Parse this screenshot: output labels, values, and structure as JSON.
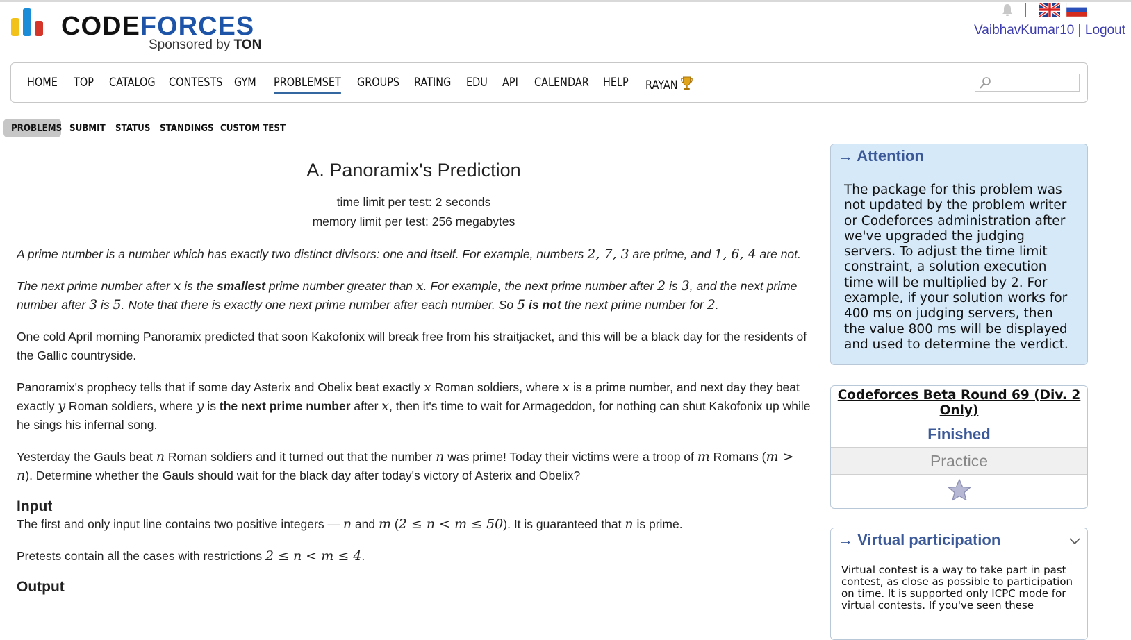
{
  "header": {
    "logo_text_left": "CODE",
    "logo_text_right": "FORCES",
    "sponsor_prefix": "Sponsored by ",
    "sponsor_name": "TON",
    "username": "VaibhavKumar10",
    "separator": "|",
    "logout": "Logout"
  },
  "nav": {
    "items": [
      "HOME",
      "TOP",
      "CATALOG",
      "CONTESTS",
      "GYM",
      "PROBLEMSET",
      "GROUPS",
      "RATING",
      "EDU",
      "API",
      "CALENDAR",
      "HELP",
      "RAYAN"
    ],
    "active": "PROBLEMSET"
  },
  "subnav": {
    "items": [
      "PROBLEMS",
      "SUBMIT",
      "STATUS",
      "STANDINGS",
      "CUSTOM TEST"
    ],
    "active": "PROBLEMS"
  },
  "problem": {
    "title": "A. Panoramix's Prediction",
    "time_limit": "time limit per test: 2 seconds",
    "memory_limit": "memory limit per test: 256 megabytes",
    "p1": {
      "a": "A prime number is a number which has exactly two distinct divisors: one and itself. For example, numbers ",
      "m1": "2, 7, 3",
      "b": " are prime, and ",
      "m2": "1, 6, 4",
      "c": " are not."
    },
    "p2": {
      "a": "The next prime number after ",
      "x1": "x",
      "b": " is the ",
      "bold1": "smallest",
      "c": " prime number greater than ",
      "x2": "x",
      "d": ". For example, the next prime number after ",
      "n2": "2",
      "e": " is ",
      "n3": "3",
      "f": ", and the next prime number after ",
      "n3b": "3",
      "g": " is ",
      "n5": "5",
      "h": ". Note that there is exactly one next prime number after each number. So ",
      "n5b": "5",
      "i": " ",
      "bold2": "is not",
      "j": " the next prime number for ",
      "n2b": "2",
      "k": "."
    },
    "p3": "One cold April morning Panoramix predicted that soon Kakofonix will break free from his straitjacket, and this will be a black day for the residents of the Gallic countryside.",
    "p4": {
      "a": "Panoramix's prophecy tells that if some day Asterix and Obelix beat exactly ",
      "x1": "x",
      "b": " Roman soldiers, where ",
      "x2": "x",
      "c": " is a prime number, and next day they beat exactly ",
      "y1": "y",
      "d": " Roman soldiers, where ",
      "y2": "y",
      "e": " is ",
      "bold": "the next prime number",
      "f": " after ",
      "x3": "x",
      "g": ", then it's time to wait for Armageddon, for nothing can shut Kakofonix up while he sings his infernal song."
    },
    "p5": {
      "a": "Yesterday the Gauls beat ",
      "n1": "n",
      "b": " Roman soldiers and it turned out that the number ",
      "n2": "n",
      "c": " was prime! Today their victims were a troop of ",
      "m1": "m",
      "d": " Romans (",
      "ineq": "m > n",
      "e": "). Determine whether the Gauls should wait for the black day after today's victory of Asterix and Obelix?"
    },
    "input_heading": "Input",
    "input": {
      "a": "The first and only input line contains two positive integers — ",
      "n": "n",
      "b": " and ",
      "m": "m",
      "c": " (",
      "range": "2 ≤ n < m ≤ 50",
      "d": "). It is guaranteed that ",
      "n2": "n",
      "e": " is prime."
    },
    "pretests": {
      "a": "Pretests contain all the cases with restrictions ",
      "range": "2 ≤ n < m ≤ 4",
      "b": "."
    },
    "output_heading": "Output"
  },
  "sidebar": {
    "attention_title": "→ Attention",
    "attention_text": "The package for this problem was not updated by the problem writer or Codeforces administration after we've upgraded the judging servers. To adjust the time limit constraint, a solution execution time will be multiplied by 2. For example, if your solution works for 400 ms on judging servers, then the value 800 ms will be displayed and used to determine the verdict.",
    "contest_name": "Codeforces Beta Round 69 (Div. 2 Only)",
    "contest_status": "Finished",
    "practice": "Practice",
    "virtual_title": "→ Virtual participation",
    "virtual_text": "Virtual contest is a way to take part in past contest, as close as possible to participation on time. It is supported only ICPC mode for virtual contests. If you've seen these"
  }
}
